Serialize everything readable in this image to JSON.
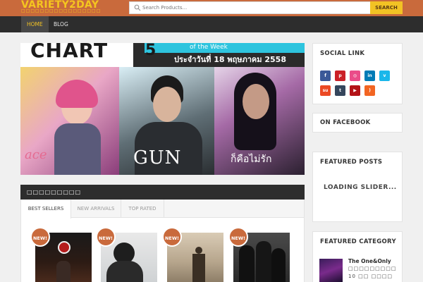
{
  "header": {
    "logo": "VARIETY2DAY",
    "logo_sub": "□□□□□□□□□□□□□□□□□",
    "search": {
      "placeholder": "Search Products...",
      "button_label": "SEARCH"
    }
  },
  "nav": {
    "items": [
      {
        "label": "HOME",
        "active": true
      },
      {
        "label": "BLOG",
        "active": false
      }
    ]
  },
  "banner": {
    "chart_label": "CHART",
    "week_number": "5",
    "week_label": "of the Week",
    "date_text": "ประจำวันที่ 18 พฤษภาคม 2558",
    "artist_left_text": "ace",
    "artist_center_name": "GUN",
    "song_right_text": "ก็คือไม่รัก"
  },
  "section": {
    "title": "□□□□□□□□□",
    "tabs": [
      {
        "label": "BEST SELLERS",
        "active": true
      },
      {
        "label": "NEW ARRIVALS",
        "active": false
      },
      {
        "label": "TOP RATED",
        "active": false
      }
    ],
    "products": [
      {
        "badge": "NEW!"
      },
      {
        "badge": "NEW!"
      },
      {
        "badge": "NEW!"
      },
      {
        "badge": "NEW!"
      }
    ]
  },
  "sidebar": {
    "social": {
      "title": "SOCIAL LINK",
      "links": [
        {
          "icon": "facebook-icon",
          "glyph": "f",
          "color": "#3b5998"
        },
        {
          "icon": "pinterest-icon",
          "glyph": "p",
          "color": "#cb2027"
        },
        {
          "icon": "dribbble-icon",
          "glyph": "◎",
          "color": "#ea4c89"
        },
        {
          "icon": "linkedin-icon",
          "glyph": "in",
          "color": "#007bb6"
        },
        {
          "icon": "vimeo-icon",
          "glyph": "v",
          "color": "#1ab7ea"
        },
        {
          "icon": "stumbleupon-icon",
          "glyph": "su",
          "color": "#eb4924"
        },
        {
          "icon": "tumblr-icon",
          "glyph": "t",
          "color": "#35465c"
        },
        {
          "icon": "youtube-icon",
          "glyph": "▶",
          "color": "#b31217"
        },
        {
          "icon": "rss-icon",
          "glyph": ")",
          "color": "#f26522"
        }
      ]
    },
    "facebook": {
      "title": "ON FACEBOOK"
    },
    "featured_posts": {
      "title": "FEATURED POSTS",
      "loading_text": "LOADING SLIDER..."
    },
    "featured_category": {
      "title": "FEATURED CATEGORY",
      "item_title": "The One&Only",
      "line1": "□□□□□□□□□",
      "line2": "10 □□ □□□□"
    }
  },
  "colors": {
    "topbar": "#c96a3c",
    "accent_yellow": "#f2c224",
    "nav_bg": "#2d2d2d"
  }
}
